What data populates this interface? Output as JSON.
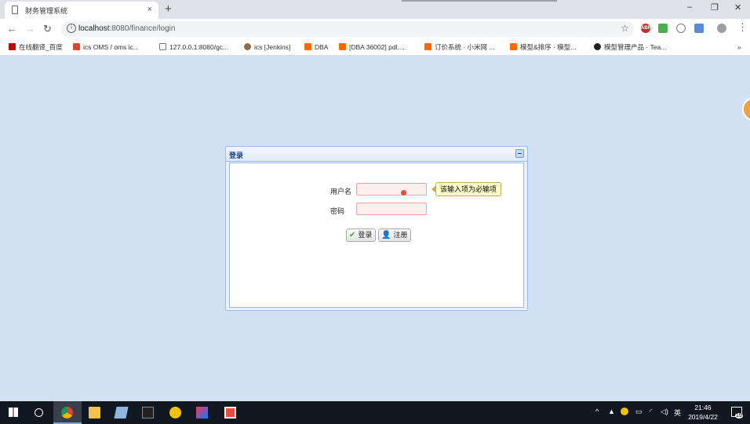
{
  "browser": {
    "tab_title": "财务管理系统",
    "tab_close": "×",
    "new_tab": "+",
    "url_host": "localhost",
    "url_path": ":8080/finance/login",
    "window": {
      "minimize": "–",
      "maximize": "❐",
      "close": "✕"
    },
    "bookmarks": [
      {
        "label": "在线翻译_百度",
        "color": "#c00"
      },
      {
        "label": "ics OMS / oms ic...",
        "color": "#e24329"
      },
      {
        "label": "127.0.0.1:8080/gc...",
        "color": "#777"
      },
      {
        "label": "ics [Jenkins]",
        "color": "#8b6d4a"
      },
      {
        "label": "DBA",
        "color": "#ff6700"
      },
      {
        "label": "[DBA 36002] pdl....",
        "color": "#ff6700"
      },
      {
        "label": "订价系统 · 小米网 ...",
        "color": "#ff6700"
      },
      {
        "label": "模型&排序 · 模型...",
        "color": "#ff6700"
      },
      {
        "label": "模型管理产品 · Tea...",
        "color": "#222"
      }
    ],
    "bookmarks_more": "»"
  },
  "login": {
    "panel_title": "登录",
    "username_label": "用户名",
    "password_label": "密码",
    "username_value": "",
    "password_value": "",
    "validation_tooltip": "该输入项为必输项",
    "login_button": "登录",
    "register_button": "注册"
  },
  "taskbar": {
    "ime": "英",
    "time": "21:46",
    "date": "2019/4/22",
    "notification_count": "19"
  }
}
